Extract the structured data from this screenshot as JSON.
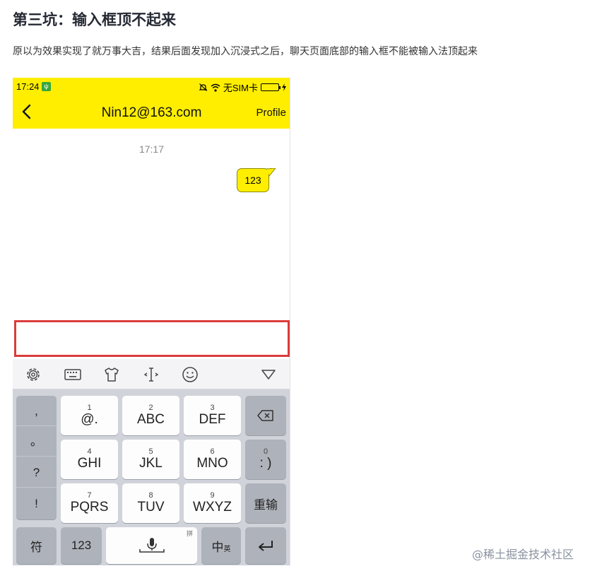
{
  "article": {
    "heading": "第三坑：输入框顶不起来",
    "description": "原以为效果实现了就万事大吉，结果后面发现加入沉浸式之后，聊天页面底部的输入框不能被输入法顶起来"
  },
  "status_bar": {
    "time": "17:24",
    "usb_symbol": "ψ",
    "carrier": "无SIM卡",
    "background": "#ffee00"
  },
  "app_bar": {
    "title": "Nin12@163.com",
    "profile_label": "Profile",
    "background": "#ffee00"
  },
  "chat": {
    "timestamp": "17:17",
    "messages": [
      {
        "text": "123",
        "from": "me"
      }
    ]
  },
  "input_box": {
    "highlight_color": "#db3c3c",
    "value": ""
  },
  "keyboard": {
    "toolbar_icons": [
      "gear-icon",
      "keyboard-icon",
      "tshirt-icon",
      "cursor-icon",
      "smiley-icon",
      "triangle-down-icon"
    ],
    "punctuation": [
      ",",
      "。",
      "?",
      "!"
    ],
    "keys": {
      "k1": {
        "num": "1",
        "letters": "@."
      },
      "k2": {
        "num": "2",
        "letters": "ABC"
      },
      "k3": {
        "num": "3",
        "letters": "DEF"
      },
      "k4": {
        "num": "4",
        "letters": "GHI"
      },
      "k5": {
        "num": "5",
        "letters": "JKL"
      },
      "k6": {
        "num": "6",
        "letters": "MNO"
      },
      "k7": {
        "num": "7",
        "letters": "PQRS"
      },
      "k8": {
        "num": "8",
        "letters": "TUV"
      },
      "k9": {
        "num": "9",
        "letters": "WXYZ"
      },
      "k0": {
        "num": "0",
        "letters": ": )"
      }
    },
    "reinput_label": "重输",
    "symbols_label": "符",
    "numbers_label": "123",
    "pinyin_mark": "拼",
    "lang_main": "中",
    "lang_sub": "英"
  },
  "watermark": "@稀土掘金技术社区"
}
